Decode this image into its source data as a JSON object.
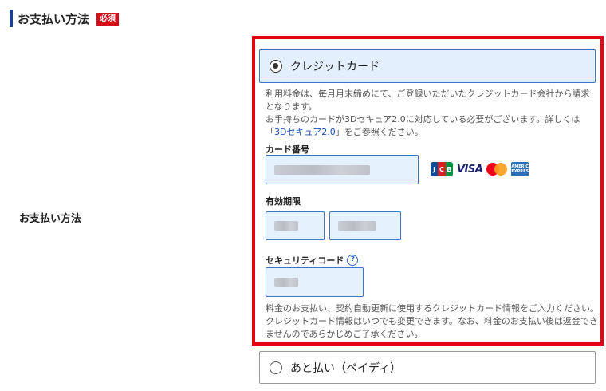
{
  "section": {
    "title": "お支払い方法",
    "required_badge": "必須"
  },
  "row_label": "お支払い方法",
  "options": [
    {
      "label": "クレジットカード",
      "selected": true
    },
    {
      "label": "あと払い（ペイディ）",
      "selected": false
    }
  ],
  "card_info": {
    "line1": "利用料金は、毎月月末締めにて、ご登録いただいたクレジットカード会社から請求となります。",
    "line2_prefix": "お手持ちのカードが3Dセキュア2.0に対応している必要がございます。詳しくは「",
    "link_text": "3Dセキュア2.0",
    "line2_suffix": "」をご参照ください。"
  },
  "fields": {
    "card_number": {
      "label": "カード番号",
      "value_state": "masked"
    },
    "expiry": {
      "label": "有効期限",
      "month_state": "masked",
      "year_state": "masked"
    },
    "security_code": {
      "label": "セキュリティコード",
      "help_glyph": "?",
      "value_state": "masked"
    }
  },
  "brands": {
    "jcb": [
      "J",
      "C",
      "B"
    ],
    "visa": "VISA",
    "amex": "AMERICAN EXPRESS",
    "colors": {
      "jcb_blue": "#0e4c96",
      "jcb_red": "#d71f26",
      "jcb_green": "#00923f",
      "visa": "#1a1f71",
      "mc_red": "#eb001b",
      "mc_yellow": "#f79e1b",
      "amex": "#2671b9"
    }
  },
  "note": "料金のお支払い、契約自動更新に使用するクレジットカード情報をご入力ください。クレジットカード情報はいつでも変更できます。なお、料金のお支払い後は返金できませんのであらかじめご了承ください。",
  "colors": {
    "highlight_frame": "#e60012",
    "required_badge": "#d70c19",
    "section_bar": "#1d3f8e",
    "selected_option_bg": "#e4effd",
    "input_bg": "#e6f1fe",
    "input_border": "#3f73c4"
  }
}
